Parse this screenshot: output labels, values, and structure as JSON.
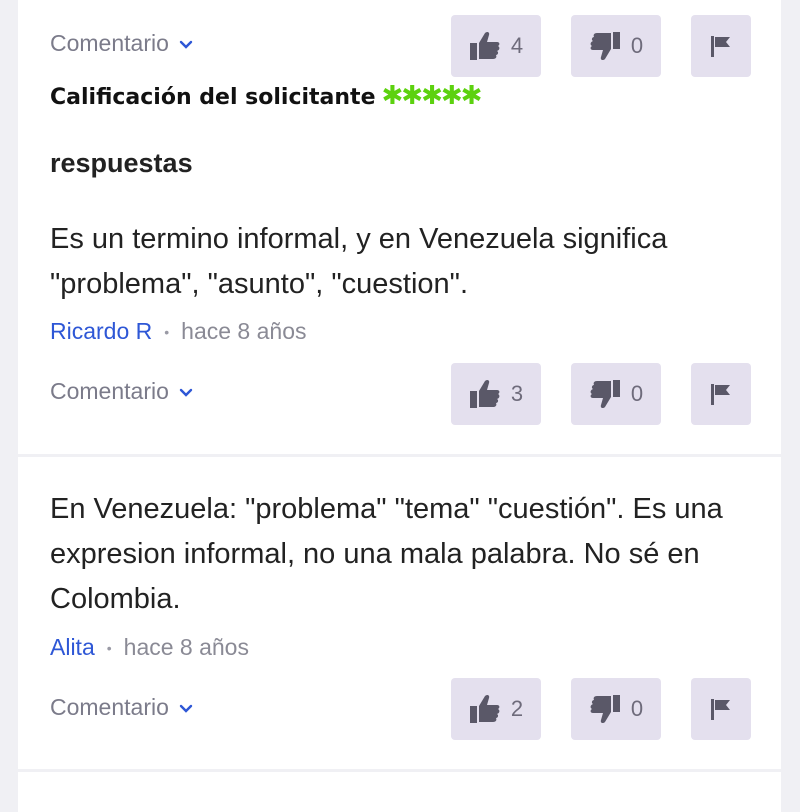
{
  "colors": {
    "accent_link": "#2e57d6",
    "stars": "#5cd10f",
    "button_bg": "#e4e0ee"
  },
  "top": {
    "comment_label": "Comentario",
    "thumbs_up_count": "4",
    "thumbs_down_count": "0"
  },
  "rating": {
    "label": "Calificación del solicitante",
    "stars": "✱✱✱✱✱"
  },
  "section_title": "respuestas",
  "answers": [
    {
      "text": "Es un termino informal, y en Venezuela significa \"problema\", \"asunto\", \"cuestion\".",
      "author": "Ricardo R",
      "separator": "•",
      "time": "hace 8 años",
      "comment_label": "Comentario",
      "thumbs_up_count": "3",
      "thumbs_down_count": "0"
    },
    {
      "text": "En Venezuela: \"problema\" \"tema\" \"cuestión\". Es una expresion informal, no una mala palabra. No sé en Colombia.",
      "author": "Alita",
      "separator": "•",
      "time": "hace 8 años",
      "comment_label": "Comentario",
      "thumbs_up_count": "2",
      "thumbs_down_count": "0"
    }
  ],
  "icons": {
    "thumbs_up": "thumbs-up-icon",
    "thumbs_down": "thumbs-down-icon",
    "flag": "flag-icon",
    "chevron": "chevron-down-icon"
  }
}
